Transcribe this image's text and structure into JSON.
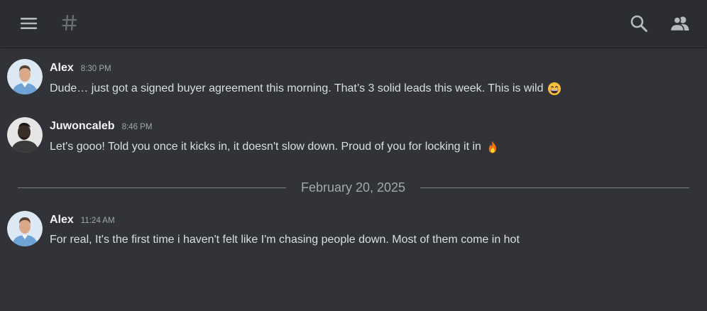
{
  "topbar": {
    "icons": [
      "hamburger-menu-icon",
      "hash-icon",
      "search-icon",
      "members-icon"
    ]
  },
  "messages": [
    {
      "author": "Alex",
      "time": "8:30 PM",
      "text": "Dude… just got a signed buyer agreement this morning. That’s 3 solid leads this week. This is wild",
      "emoji": "grinning-face-with-smiling-eyes-emoji",
      "avatar": "alex-avatar"
    },
    {
      "author": "Juwoncaleb",
      "time": "8:46 PM",
      "text": "Let's gooo! Told you once it kicks in, it doesn't slow down. Proud of you for locking it in",
      "emoji": "fire-emoji",
      "avatar": "juwoncaleb-avatar"
    },
    {
      "author": "Alex",
      "time": "11:24 AM",
      "text": "For real, It's the first time i haven't felt like I'm chasing people down. Most of them come in hot",
      "avatar": "alex-avatar"
    }
  ],
  "divider": {
    "date": "February 20, 2025"
  },
  "colors": {
    "background": "#313338",
    "topbar": "#2b2d31",
    "text": "#dbdee1",
    "username": "#f2f3f5",
    "muted": "#a3a6aa"
  }
}
